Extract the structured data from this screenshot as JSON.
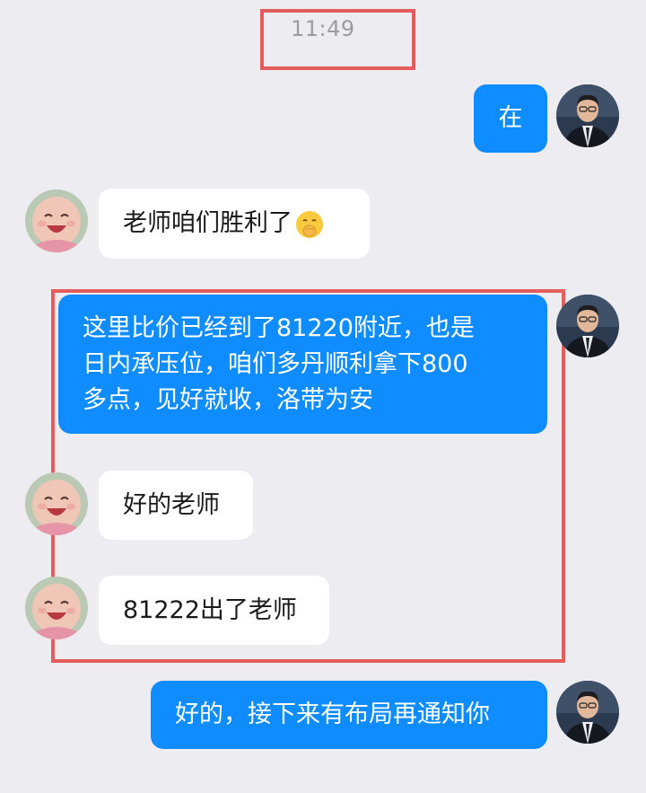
{
  "chat": {
    "timestamp": "11:49",
    "messages": [
      {
        "id": "m1",
        "direction": "outgoing",
        "sender": "teacher",
        "text": "在"
      },
      {
        "id": "m2",
        "direction": "incoming",
        "sender": "student",
        "text": "老师咱们胜利了",
        "emoji": "shushing-face-icon"
      },
      {
        "id": "m3",
        "direction": "outgoing",
        "sender": "teacher",
        "lines": [
          "这里比价已经到了81220附近，也是",
          "日内承压位，咱们多丹顺利拿下800",
          "多点，见好就收，洛带为安"
        ]
      },
      {
        "id": "m4",
        "direction": "incoming",
        "sender": "student",
        "text": "好的老师"
      },
      {
        "id": "m5",
        "direction": "incoming",
        "sender": "student",
        "text": "81222出了老师"
      },
      {
        "id": "m6",
        "direction": "outgoing",
        "sender": "teacher",
        "text": "好的，接下来有布局再通知你"
      }
    ]
  },
  "colors": {
    "background": "#ededf1",
    "outgoing_bubble": "#0f8cff",
    "incoming_bubble": "#ffffff",
    "annotation": "#e45c5c",
    "timestamp": "#9c9ca0"
  },
  "avatars": {
    "teacher": "man-in-suit-avatar",
    "student": "laughing-baby-avatar"
  }
}
